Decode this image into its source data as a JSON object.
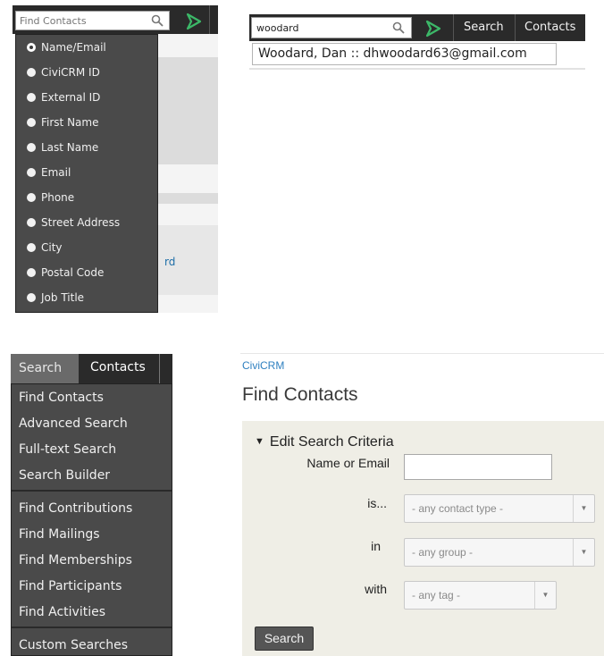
{
  "quick_search": {
    "placeholder": "Find Contacts",
    "options": [
      {
        "label": "Name/Email",
        "selected": true
      },
      {
        "label": "CiviCRM ID",
        "selected": false
      },
      {
        "label": "External ID",
        "selected": false
      },
      {
        "label": "First Name",
        "selected": false
      },
      {
        "label": "Last Name",
        "selected": false
      },
      {
        "label": "Email",
        "selected": false
      },
      {
        "label": "Phone",
        "selected": false
      },
      {
        "label": "Street Address",
        "selected": false
      },
      {
        "label": "City",
        "selected": false
      },
      {
        "label": "Postal Code",
        "selected": false
      },
      {
        "label": "Job Title",
        "selected": false
      }
    ],
    "bg_link_fragment": "rd"
  },
  "typed_search": {
    "value": "woodard",
    "nav_search": "Search",
    "nav_contacts": "Contacts",
    "suggestion": "Woodard, Dan :: dhwoodard63@gmail.com"
  },
  "search_menu": {
    "tab_search": "Search",
    "tab_contacts": "Contacts",
    "groups": [
      [
        "Find Contacts",
        "Advanced Search",
        "Full-text Search",
        "Search Builder"
      ],
      [
        "Find Contributions",
        "Find Mailings",
        "Find Memberships",
        "Find Participants",
        "Find Activities"
      ],
      [
        "Custom Searches"
      ]
    ]
  },
  "find_contacts_page": {
    "breadcrumb": "CiviCRM",
    "title": "Find Contacts",
    "section": "Edit Search Criteria",
    "name_label": "Name or Email",
    "name_value": "",
    "is_label": "is...",
    "contact_type": "- any contact type -",
    "in_label": "in",
    "group": "- any group -",
    "with_label": "with",
    "tag": "- any tag -",
    "search_button": "Search"
  },
  "colors": {
    "menu_bg": "#4a4a4a",
    "bar_bg": "#2a2a2a",
    "logo_green": "#3cb868",
    "link_blue": "#2f80c0",
    "panel_bg": "#efeee6"
  }
}
